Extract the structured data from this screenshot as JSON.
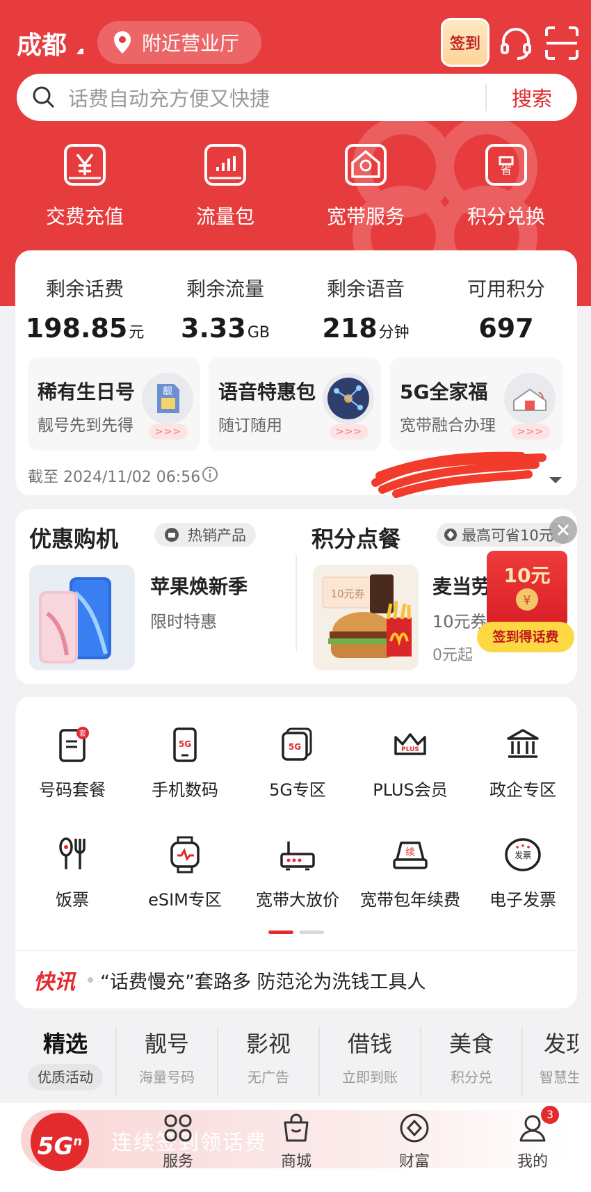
{
  "header": {
    "city": "成都",
    "nearby": "附近营业厅",
    "signin": "签到"
  },
  "search": {
    "placeholder": "话费自动充方便又快捷",
    "button": "搜索"
  },
  "quick_nav": [
    {
      "label": "交费充值",
      "icon": "yen-card-icon"
    },
    {
      "label": "流量包",
      "icon": "bar-chart-icon"
    },
    {
      "label": "宽带服务",
      "icon": "house-network-icon"
    },
    {
      "label": "积分兑换",
      "icon": "save-coupon-icon"
    }
  ],
  "balances": [
    {
      "title": "剩余话费",
      "value": "198.85",
      "unit": "元"
    },
    {
      "title": "剩余流量",
      "value": "3.33",
      "unit": "GB"
    },
    {
      "title": "剩余语音",
      "value": "218",
      "unit": "分钟"
    },
    {
      "title": "可用积分",
      "value": "697",
      "unit": ""
    }
  ],
  "promos": [
    {
      "title": "稀有生日号",
      "subtitle": "靓号先到先得",
      "badge": "靓"
    },
    {
      "title": "语音特惠包",
      "subtitle": "随订随用"
    },
    {
      "title": "5G全家福",
      "subtitle": "宽带融合办理"
    }
  ],
  "promo_arrow": ">>>",
  "as_of": "截至 2024/11/02 06:56",
  "shop": {
    "left": {
      "title": "优惠购机",
      "pill": "热销产品",
      "product": "苹果焕新季",
      "sub": "限时特惠"
    },
    "right": {
      "title": "积分点餐",
      "pill": "最高可省10元",
      "product": "麦当劳",
      "sub": "10元券",
      "price": "0元起",
      "coupon_text": "10元券"
    }
  },
  "red_packet": {
    "amount": "10元",
    "cta": "签到得话费"
  },
  "grid": [
    {
      "label": "号码套餐",
      "icon": "sim-package-icon",
      "badge": "套"
    },
    {
      "label": "手机数码",
      "icon": "phone-5g-icon",
      "badge": "5G"
    },
    {
      "label": "5G专区",
      "icon": "5g-zone-icon",
      "badge": "5G"
    },
    {
      "label": "PLUS会员",
      "icon": "crown-plus-icon",
      "badge": "PLUS"
    },
    {
      "label": "政企专区",
      "icon": "government-building-icon"
    },
    {
      "label": "饭票",
      "icon": "spoon-fork-icon"
    },
    {
      "label": "eSIM专区",
      "icon": "smartwatch-icon"
    },
    {
      "label": "宽带大放价",
      "icon": "router-icon"
    },
    {
      "label": "宽带包年续费",
      "icon": "renew-device-icon",
      "badge": "续"
    },
    {
      "label": "电子发票",
      "icon": "invoice-icon",
      "badge": "发票"
    }
  ],
  "news": {
    "tag": "快讯",
    "text": "“话费慢充”套路多 防范沦为洗钱工具人"
  },
  "tabs": [
    {
      "title": "精选",
      "sub": "优质活动"
    },
    {
      "title": "靓号",
      "sub": "海量号码"
    },
    {
      "title": "影视",
      "sub": "无广告"
    },
    {
      "title": "借钱",
      "sub": "立即到账"
    },
    {
      "title": "美食",
      "sub": "积分兑"
    },
    {
      "title": "发现",
      "sub": "智慧生活"
    }
  ],
  "bottom_nav": {
    "logo": "5G",
    "logo_sup": "n",
    "banner": "连续签到领话费",
    "items": [
      {
        "label": "服务",
        "icon": "grid-services-icon"
      },
      {
        "label": "商城",
        "icon": "shopping-bag-icon"
      },
      {
        "label": "财富",
        "icon": "wealth-diamond-icon"
      },
      {
        "label": "我的",
        "icon": "profile-icon",
        "badge": "3"
      }
    ]
  },
  "colors": {
    "brand_red": "#e73c3e",
    "accent_red": "#e02a2f",
    "badge_red": "#e32a2d"
  }
}
